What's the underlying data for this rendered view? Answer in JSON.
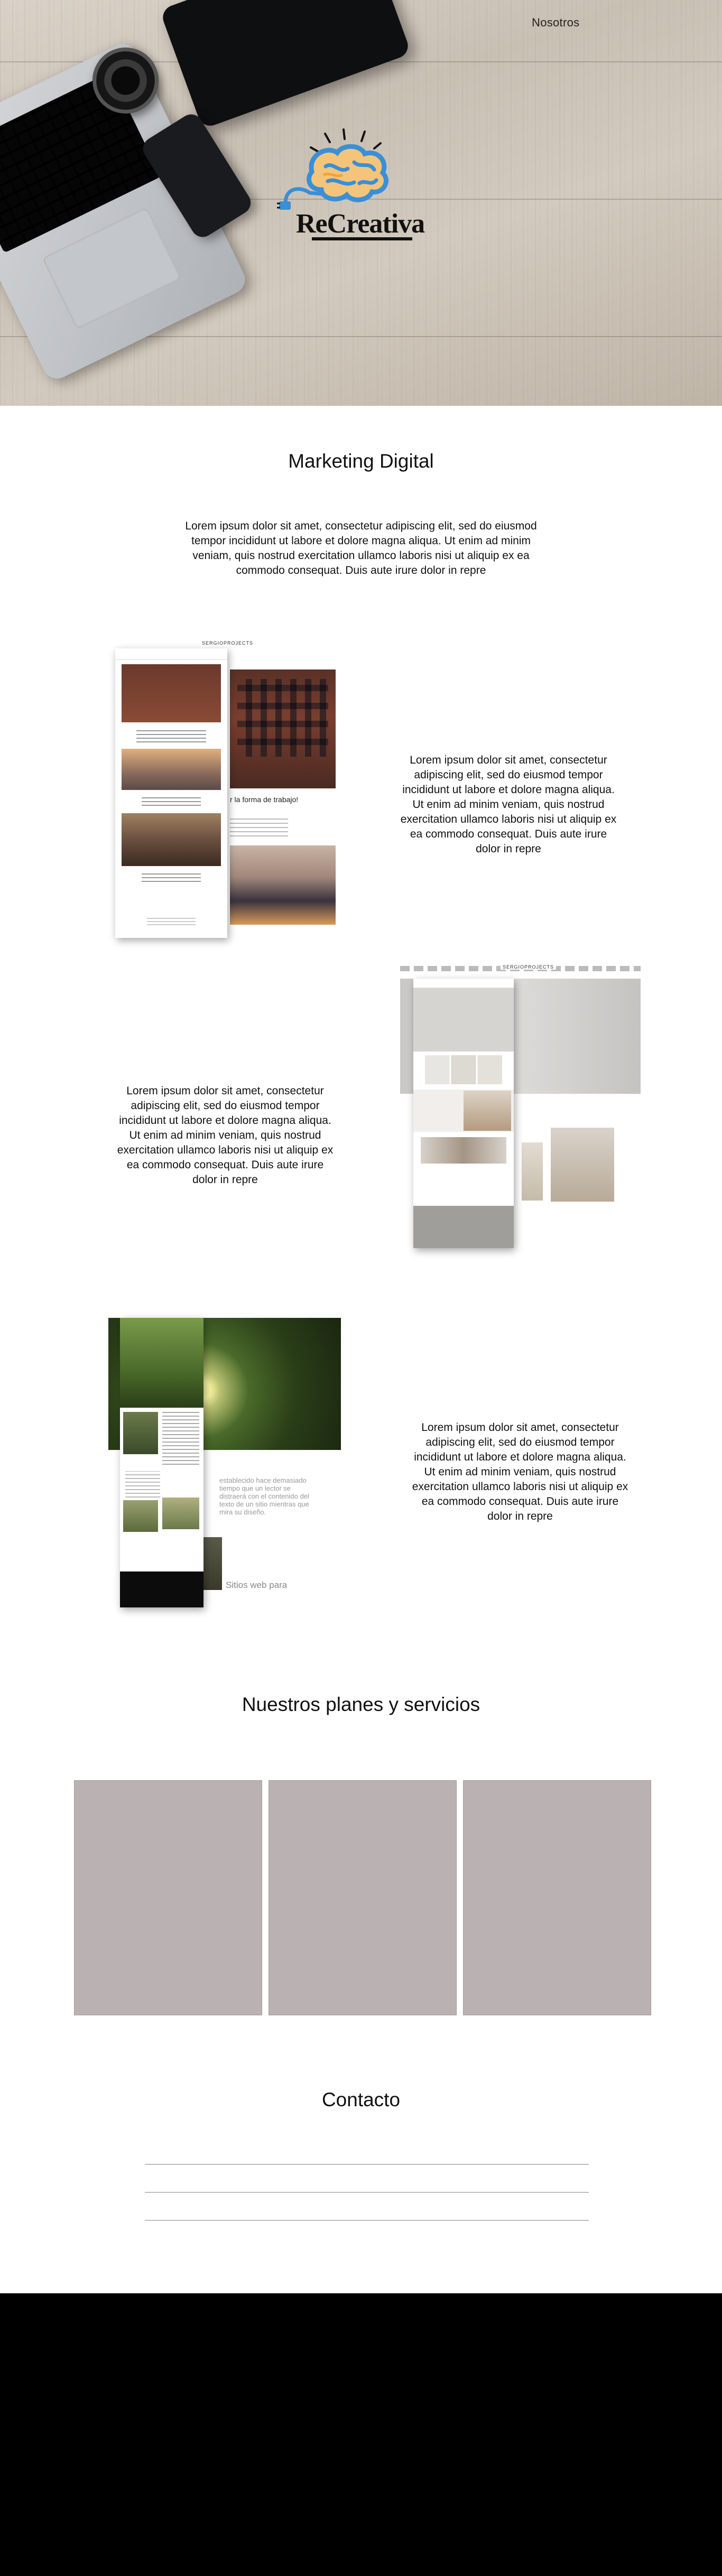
{
  "nav": {
    "link": "Nosotros"
  },
  "hero": {
    "logo_text": "ReCreativa"
  },
  "marketing": {
    "title": "Marketing Digital",
    "description": "Lorem ipsum dolor sit amet, consectetur adipiscing elit, sed do eiusmod tempor incididunt ut labore et dolore magna aliqua. Ut enim ad minim veniam, quis nostrud exercitation ullamco laboris nisi ut aliquip ex ea commodo consequat. Duis aute irure dolor in repre"
  },
  "showcase": [
    {
      "text": "Lorem ipsum dolor sit amet, consectetur adipiscing elit, sed do eiusmod tempor incididunt ut labore et dolore magna aliqua. Ut enim ad minim veniam, quis nostrud exercitation ullamco laboris nisi ut aliquip ex ea commodo consequat. Duis aute irure dolor in repre",
      "mock_brand": "SERGIOPROJECTS",
      "mock_caption": "r la forma de trabajo!"
    },
    {
      "text": "Lorem ipsum dolor sit amet, consectetur adipiscing elit, sed do eiusmod tempor incididunt ut labore et dolore magna aliqua. Ut enim ad minim veniam, quis nostrud exercitation ullamco laboris nisi ut aliquip ex ea commodo consequat. Duis aute irure dolor in repre",
      "mock_brand": "SERGIOPROJECTS"
    },
    {
      "text": "Lorem ipsum dolor sit amet, consectetur adipiscing elit, sed do eiusmod tempor incididunt ut labore et dolore magna aliqua. Ut enim ad minim veniam, quis nostrud exercitation ullamco laboris nisi ut aliquip ex ea commodo consequat. Duis aute irure dolor in repre",
      "mock_caption": "establecido hace demasiado tiempo que un lector se distraerá con el contenido del texto de un sitio mientras que mira su diseño.",
      "mock_footer": "Sitios web para"
    }
  ],
  "plans": {
    "title": "Nuestros planes y servicios"
  },
  "contact": {
    "title": "Contacto"
  },
  "colors": {
    "plan_card": "#b9b1b2",
    "footer": "#000000",
    "logo_blue": "#3a8fd6",
    "logo_orange": "#f2a33a"
  }
}
